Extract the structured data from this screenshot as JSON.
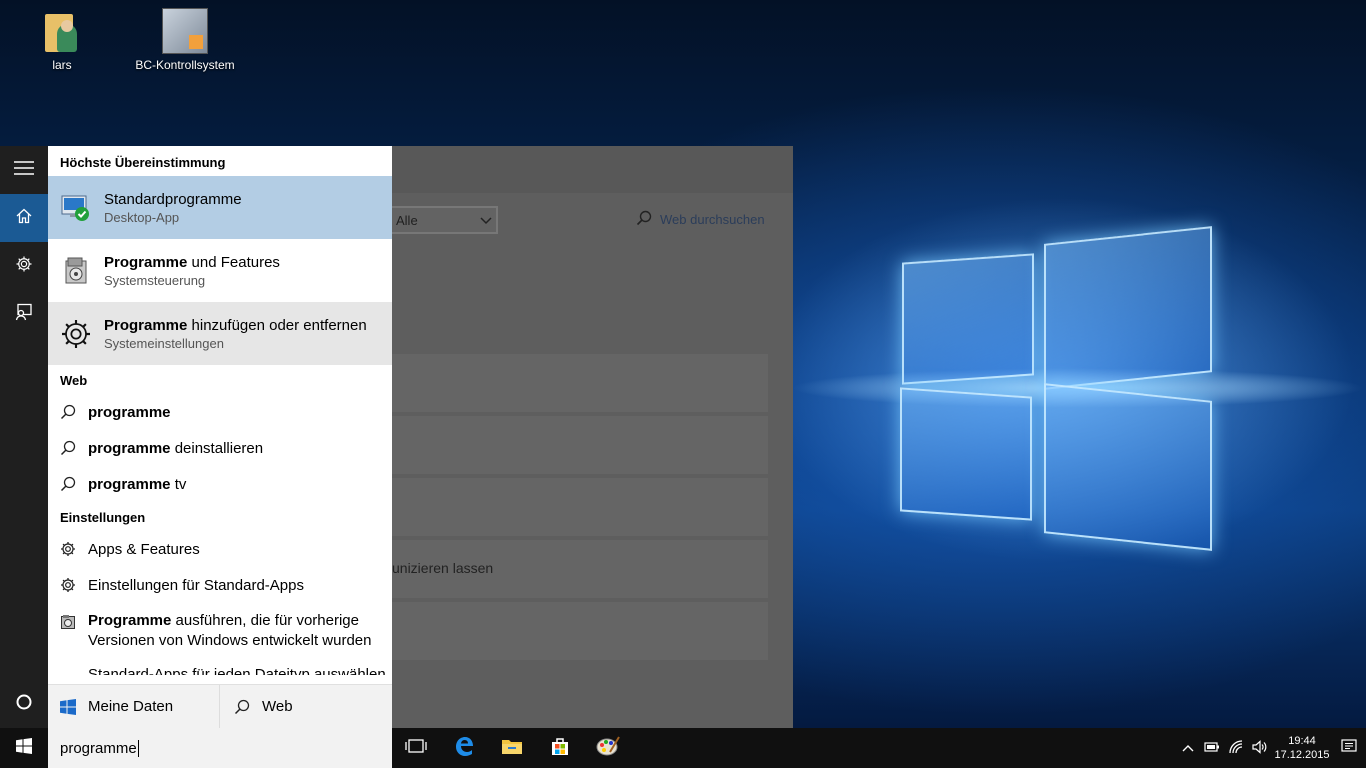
{
  "desktop": {
    "icons": [
      {
        "label": "lars",
        "icon": "user-folder-icon"
      },
      {
        "label": "BC-Kontrollsystem",
        "icon": "app-shortcut-icon"
      }
    ]
  },
  "settings_window": {
    "filter_value": "Alle",
    "web_search_label": "Web durchsuchen",
    "partial_text": "unizieren lassen"
  },
  "search_panel": {
    "best_match_header": "Höchste Übereinstimmung",
    "results": [
      {
        "title_bold": "Standardprogramme",
        "title_rest": "",
        "subtitle": "Desktop-App",
        "state": "selected",
        "icon": "default-programs-icon"
      },
      {
        "title_bold": "Programme",
        "title_rest": " und Features",
        "subtitle": "Systemsteuerung",
        "state": "normal",
        "icon": "programs-features-icon"
      },
      {
        "title_bold": "Programme",
        "title_rest": " hinzufügen oder entfernen",
        "subtitle": "Systemeinstellungen",
        "state": "hover",
        "icon": "gear-icon"
      }
    ],
    "web_header": "Web",
    "web_items": [
      {
        "bold": "programme",
        "rest": ""
      },
      {
        "bold": "programme",
        "rest": " deinstallieren"
      },
      {
        "bold": "programme",
        "rest": " tv"
      }
    ],
    "settings_header": "Einstellungen",
    "settings_items": [
      {
        "bold": "",
        "rest": "Apps & Features",
        "icon": "gear-icon"
      },
      {
        "bold": "",
        "rest": "Einstellungen für Standard-Apps",
        "icon": "gear-icon"
      },
      {
        "bold": "Programme",
        "rest": " ausführen, die für vorherige",
        "line2": "Versionen von Windows entwickelt wurden",
        "icon": "compat-icon"
      }
    ],
    "cut_item": "Standard-Apps für jeden Dateityp auswählen"
  },
  "scope": {
    "mine": "Meine Daten",
    "web": "Web"
  },
  "taskbar": {
    "search_value": "programme",
    "time": "19:44",
    "date": "17.12.2015"
  },
  "colors": {
    "accent": "#1b5a94",
    "selected": "#b3cde4",
    "taskbar": "#101010"
  }
}
